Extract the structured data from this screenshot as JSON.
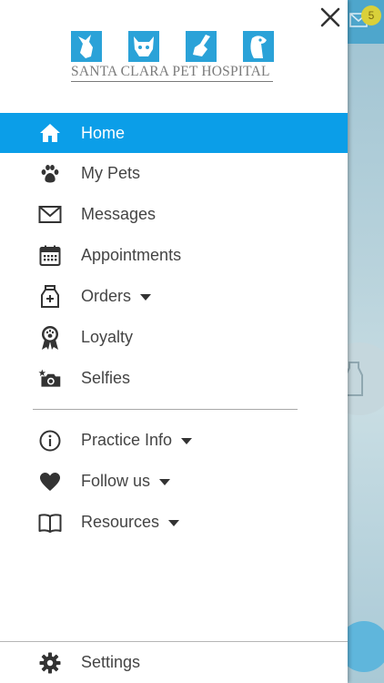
{
  "logo": {
    "text": "SANTA CLARA PET HOSPITAL",
    "tile_color": "#2aa2d8"
  },
  "background": {
    "badge_count": "5"
  },
  "menu": {
    "items": [
      {
        "label": "Home",
        "icon": "home-icon",
        "active": true
      },
      {
        "label": "My Pets",
        "icon": "paw-icon"
      },
      {
        "label": "Messages",
        "icon": "envelope-icon"
      },
      {
        "label": "Appointments",
        "icon": "calendar-icon"
      },
      {
        "label": "Orders",
        "icon": "medicine-bottle-icon",
        "dropdown": true
      },
      {
        "label": "Loyalty",
        "icon": "award-ribbon-icon"
      },
      {
        "label": "Selfies",
        "icon": "camera-icon"
      }
    ],
    "secondary": [
      {
        "label": "Practice Info",
        "icon": "info-icon",
        "dropdown": true
      },
      {
        "label": "Follow us",
        "icon": "heart-icon",
        "dropdown": true
      },
      {
        "label": "Resources",
        "icon": "book-icon",
        "dropdown": true
      }
    ],
    "settings": {
      "label": "Settings",
      "icon": "gear-icon"
    }
  },
  "colors": {
    "accent": "#0b9ee8",
    "text": "#444444",
    "icon": "#333333"
  }
}
